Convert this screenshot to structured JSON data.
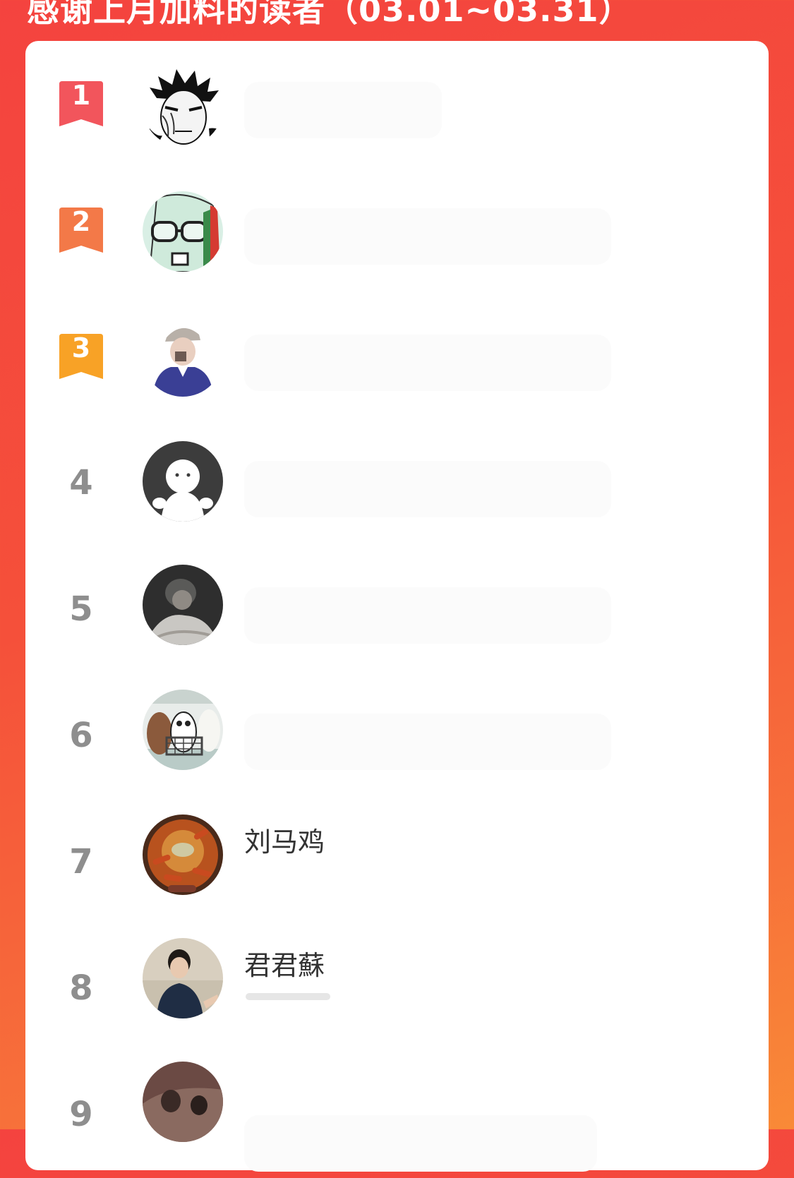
{
  "header": {
    "title": "感谢上月加料的读者（03.01~03.31）"
  },
  "leaderboard": {
    "rows": [
      {
        "rank": "1",
        "name": "",
        "avatar": "ninja-manga-avatar",
        "ribbon_color": "#f2555c"
      },
      {
        "rank": "2",
        "name": "",
        "avatar": "hero-mask-avatar",
        "ribbon_color": "#f37948"
      },
      {
        "rank": "3",
        "name": "",
        "avatar": "person-cap-avatar",
        "ribbon_color": "#f8a226"
      },
      {
        "rank": "4",
        "name": "",
        "avatar": "default-ghost-avatar"
      },
      {
        "rank": "5",
        "name": "",
        "avatar": "girl-photo-avatar"
      },
      {
        "rank": "6",
        "name": "",
        "avatar": "three-bears-avatar"
      },
      {
        "rank": "7",
        "name": "刘马鸡",
        "avatar": "food-photo-avatar"
      },
      {
        "rank": "8",
        "name": "君君蘇",
        "avatar": "man-photo-avatar"
      },
      {
        "rank": "9",
        "name": "",
        "avatar": "painting-avatar"
      }
    ]
  }
}
